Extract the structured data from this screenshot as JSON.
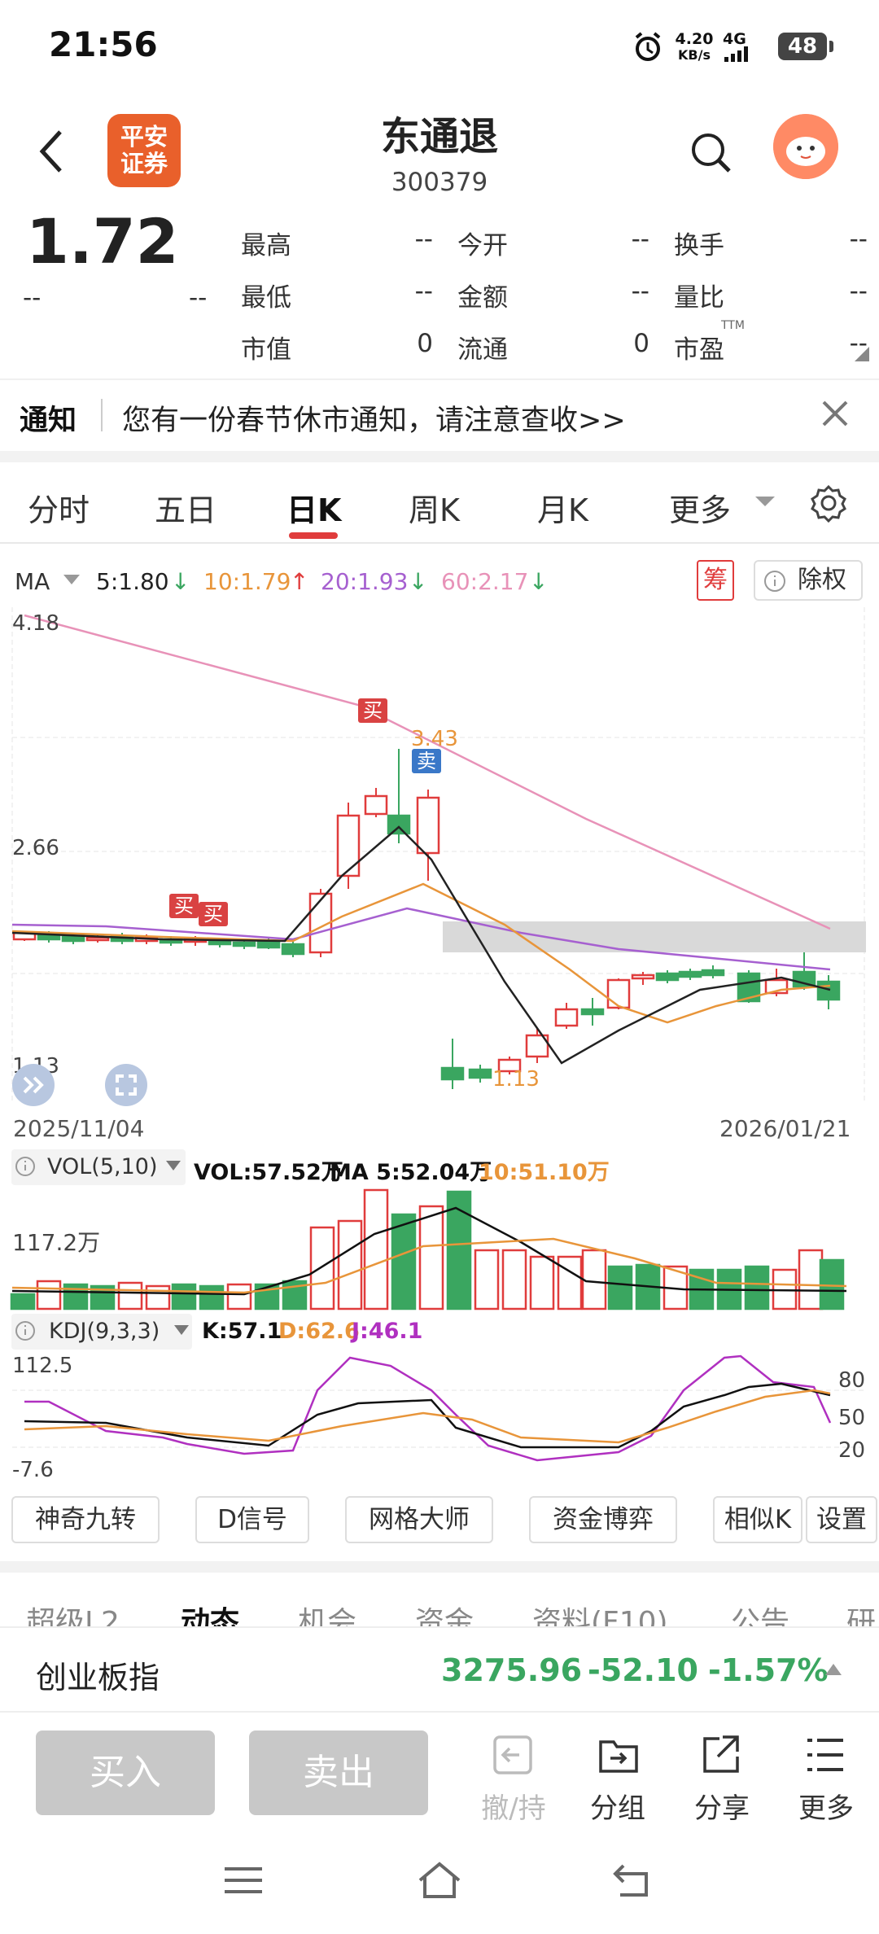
{
  "status": {
    "time": "21:56",
    "net_speed": "4.20",
    "net_unit": "KB/s",
    "signal": "4G",
    "battery": "48"
  },
  "header": {
    "title": "东通退",
    "code": "300379",
    "broker_logo_line1": "平安",
    "broker_logo_line2": "证券"
  },
  "quote": {
    "price": "1.72",
    "change": "--",
    "change_pct": "--",
    "fields": [
      {
        "label": "最高",
        "value": "--"
      },
      {
        "label": "今开",
        "value": "--"
      },
      {
        "label": "换手",
        "value": "--"
      },
      {
        "label": "最低",
        "value": "--"
      },
      {
        "label": "金额",
        "value": "--"
      },
      {
        "label": "量比",
        "value": "--"
      },
      {
        "label": "市值",
        "value": "0"
      },
      {
        "label": "流通",
        "value": "0"
      },
      {
        "label": "市盈",
        "value": "--"
      }
    ],
    "ttm": "TTM"
  },
  "notice": {
    "tag": "通知",
    "text": "您有一份春节休市通知，请注意查收>>"
  },
  "period_tabs": [
    "分时",
    "五日",
    "日K",
    "周K",
    "月K",
    "更多"
  ],
  "ma": {
    "label": "MA",
    "ma5": "5:1.80",
    "ma10": "10:1.79",
    "ma20": "20:1.93",
    "ma60": "60:2.17",
    "chou": "筹",
    "chuquan": "除权"
  },
  "kline": {
    "y_high": "4.18",
    "y_mid": "2.66",
    "y_low": "1.13",
    "date_start": "2025/11/04",
    "date_end": "2026/01/21",
    "peak_label": "3.43",
    "low_label": "1.13",
    "buy": "买",
    "sell": "卖"
  },
  "vol": {
    "label": "VOL(5,10)",
    "vol": "VOL:57.52万",
    "ma5": "MA 5:52.04万",
    "ma10": "10:51.10万",
    "axis": "117.2万"
  },
  "kdj": {
    "label": "KDJ(9,3,3)",
    "k": "K:57.1",
    "d": "D:62.6",
    "j": "J:46.1",
    "axis_top": "112.5",
    "axis_bot": "-7.6",
    "lv80": "80",
    "lv50": "50",
    "lv20": "20"
  },
  "indicator_buttons": [
    "神奇九转",
    "D信号",
    "网格大师",
    "资金博弈",
    "相似K",
    "设置"
  ],
  "bottom_tabs": [
    "超级L2",
    "动态",
    "机会",
    "资金",
    "资料(F10)",
    "公告",
    "研"
  ],
  "index_bar": {
    "name": "创业板指",
    "value": "3275.96",
    "change": "-52.10",
    "pct": "-1.57%"
  },
  "actions": {
    "buy": "买入",
    "sell": "卖出",
    "cancel": "撤/持",
    "group": "分组",
    "share": "分享",
    "more": "更多"
  },
  "colors": {
    "up": "#e03c3c",
    "down": "#3aa660",
    "ma5": "#222222",
    "ma10": "#e8953a",
    "ma20": "#a660d0",
    "ma60": "#e892b8"
  }
}
